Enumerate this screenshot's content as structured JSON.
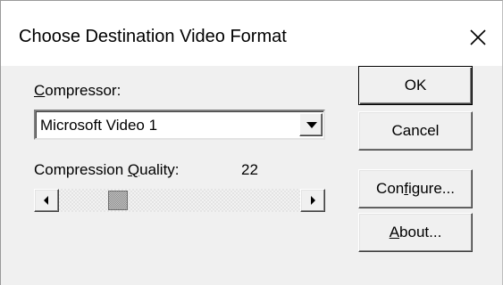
{
  "dialog": {
    "title": "Choose Destination Video Format",
    "close_icon": "close-icon"
  },
  "compressor": {
    "label_mnemonic": "C",
    "label_rest": "ompressor:",
    "selected": "Microsoft Video 1",
    "dropdown_icon": "chevron-down-icon"
  },
  "quality": {
    "label_prefix": "Compression ",
    "label_mnemonic": "Q",
    "label_rest": "uality:",
    "value_text": "22",
    "value": 22,
    "min": 0,
    "max": 100,
    "scroll_left_icon": "arrow-left-icon",
    "scroll_right_icon": "arrow-right-icon"
  },
  "buttons": {
    "ok": "OK",
    "cancel": "Cancel",
    "configure_prefix": "Con",
    "configure_mnemonic": "f",
    "configure_rest": "igure...",
    "about_mnemonic": "A",
    "about_rest": "bout..."
  },
  "colors": {
    "face": "#f0f0f0",
    "titlebar": "#ffffff",
    "text": "#000000"
  }
}
